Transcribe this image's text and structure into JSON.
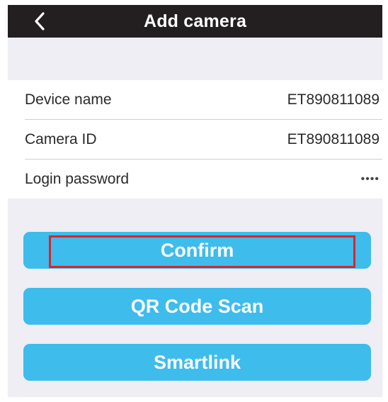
{
  "header": {
    "title": "Add camera",
    "back_icon": "chevron-left-icon"
  },
  "form": {
    "rows": [
      {
        "label": "Device name",
        "value": "ET890811089"
      },
      {
        "label": "Camera ID",
        "value": "ET890811089"
      },
      {
        "label": "Login password",
        "value": "••••"
      }
    ]
  },
  "buttons": {
    "confirm": "Confirm",
    "qr_scan": "QR Code Scan",
    "smartlink": "Smartlink"
  },
  "colors": {
    "titlebar": "#231f20",
    "button": "#3ebcec",
    "background": "#eeeef4",
    "highlight": "#d8262c"
  }
}
